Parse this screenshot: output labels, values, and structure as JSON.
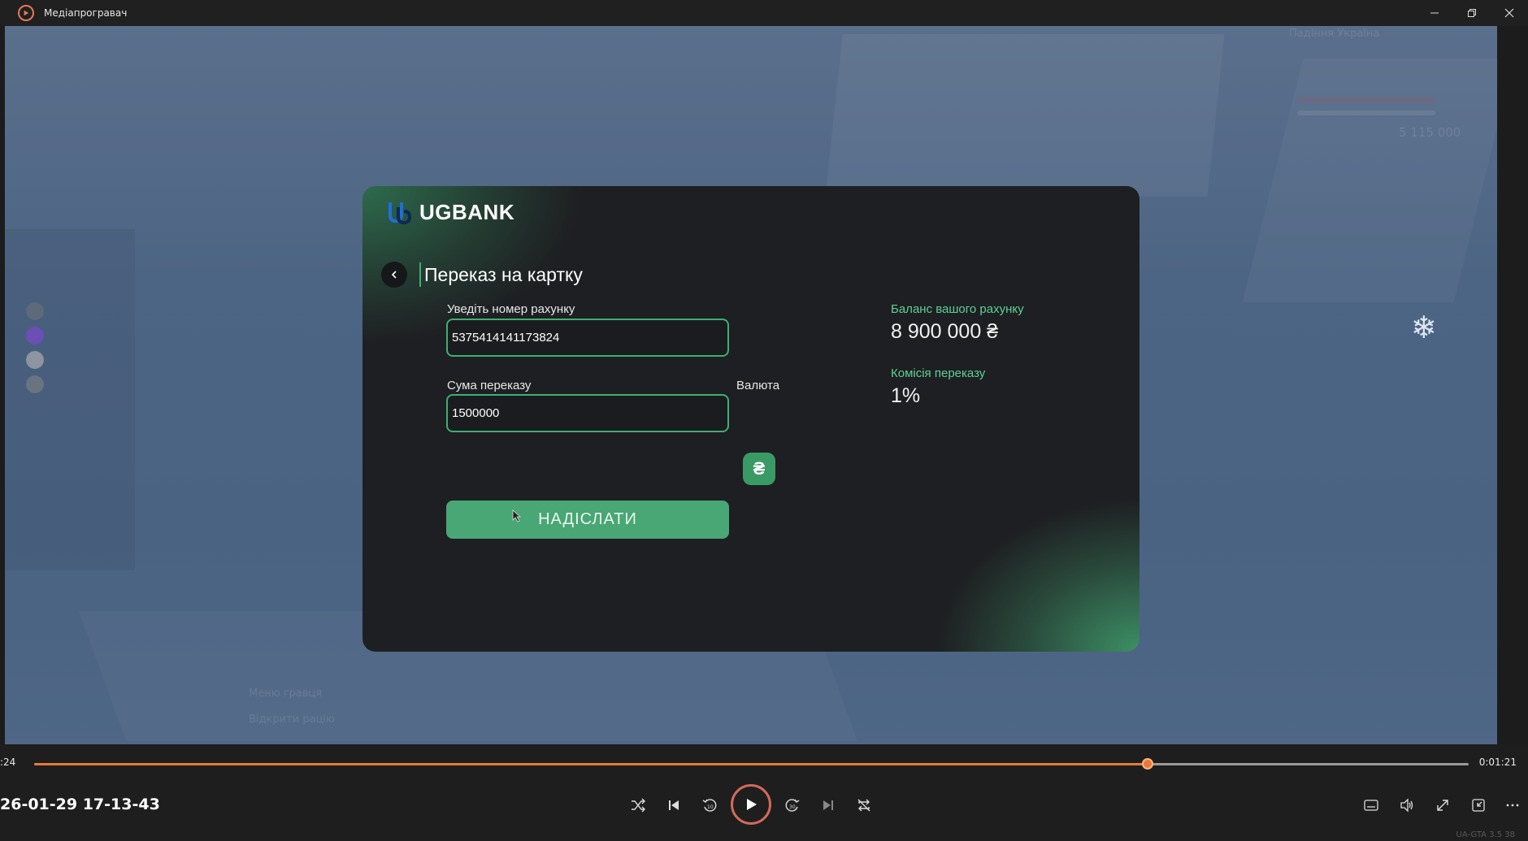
{
  "window": {
    "title": "Медіапрогравач",
    "icon": "media-player-icon"
  },
  "game": {
    "hud": {
      "location": "Падіння Україна",
      "money": "5 115 000",
      "menu_item_1": "Меню гравця",
      "menu_item_2": "Відкрити рацію"
    }
  },
  "bank": {
    "brand": "UGBANK",
    "page_title": "Переказ на картку",
    "account_label": "Уведіть номер рахунку",
    "account_value": "5375414141173824",
    "amount_label": "Сума переказу",
    "amount_value": "1500000",
    "currency_label": "Валюта",
    "currency_symbol": "₴",
    "send_label": "НАДІСЛАТИ",
    "balance_label": "Баланс вашого рахунку",
    "balance_value": "8 900 000 ₴",
    "commission_label": "Комісія переказу",
    "commission_value": "1%",
    "accent_color": "#3fae72"
  },
  "player": {
    "current_time": ":24",
    "total_time": "0:01:21",
    "progress": 0.776,
    "media_name": "26-01-29 17-13-43",
    "rewind_label": "10",
    "forward_label": "30",
    "accent_color": "#e67a3a",
    "watermark": "UA-GTA 3.5 38"
  }
}
